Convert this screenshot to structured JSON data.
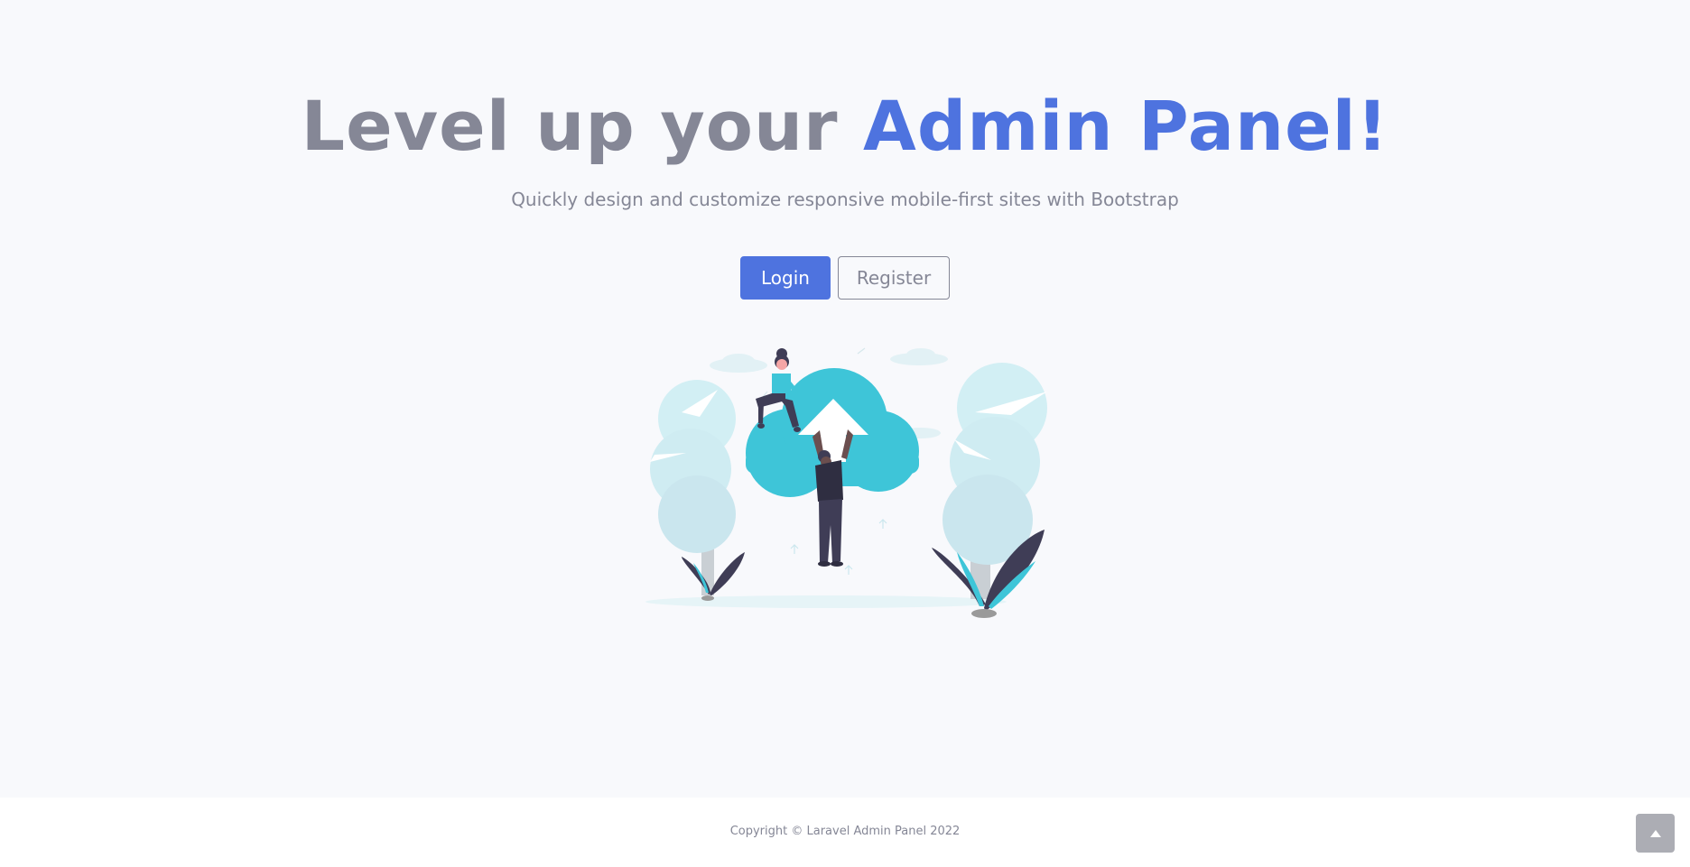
{
  "hero": {
    "headline_prefix": "Level up your ",
    "headline_accent": "Admin Panel!",
    "subtitle": "Quickly design and customize responsive mobile-first sites with Bootstrap"
  },
  "actions": {
    "login_label": "Login",
    "register_label": "Register"
  },
  "illustration": {
    "icon": "cloud-upload-people-illustration"
  },
  "footer": {
    "copyright": "Copyright © Laravel Admin Panel 2022"
  },
  "scroll_top": {
    "icon": "chevron-up-icon"
  },
  "colors": {
    "accent": "#4e73df",
    "text_muted": "#858796",
    "background": "#f8f9fc",
    "illustration_teal": "#3ec5d8",
    "illustration_light": "#cdeef3",
    "illustration_dark": "#3f3d56"
  }
}
